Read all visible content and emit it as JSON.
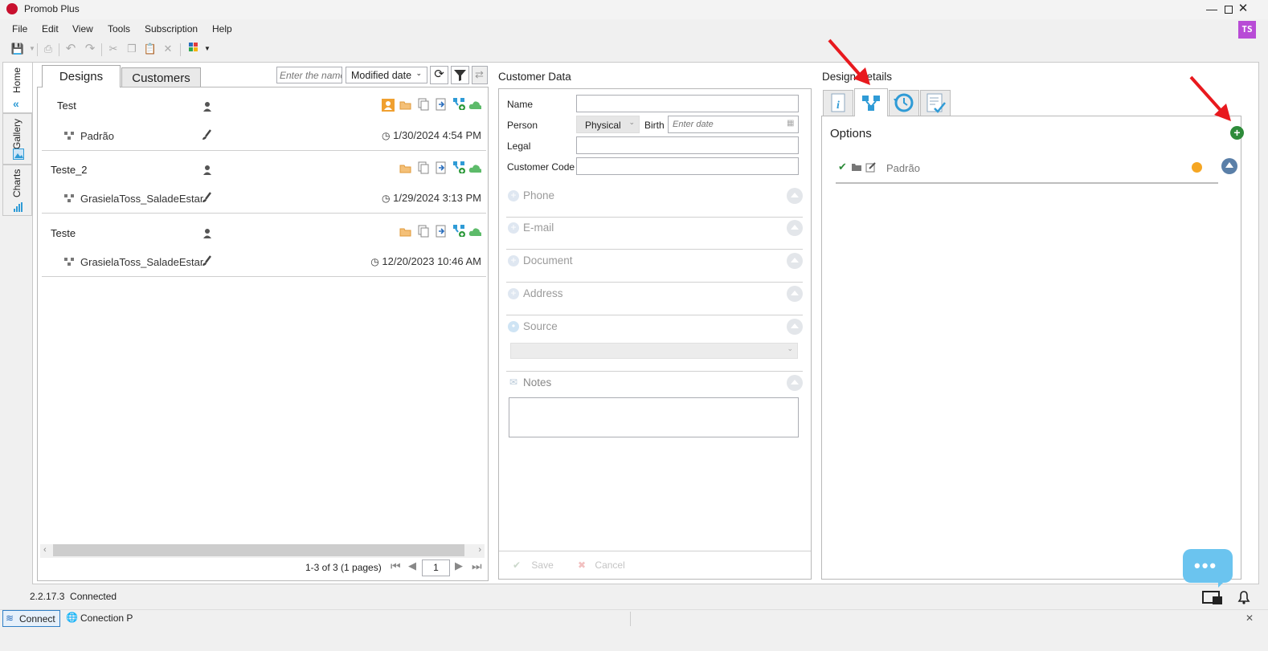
{
  "window": {
    "title": "Promob Plus",
    "avatar": "TS"
  },
  "menu": [
    "File",
    "Edit",
    "View",
    "Tools",
    "Subscription",
    "Help"
  ],
  "side_tabs": [
    "Home",
    "Gallery",
    "Charts"
  ],
  "designs_panel": {
    "tabs": [
      "Designs",
      "Customers"
    ],
    "search_placeholder": "Enter the name",
    "sort_value": "Modified date",
    "projects": [
      {
        "name": "Test",
        "option": "Padrão",
        "date": "1/30/2024 4:54 PM"
      },
      {
        "name": "Teste_2",
        "option": "GrasielaToss_SaladeEstar",
        "date": "1/29/2024 3:13 PM"
      },
      {
        "name": "Teste",
        "option": "GrasielaToss_SaladeEstar",
        "date": "12/20/2023 10:46 AM"
      }
    ],
    "pagination": {
      "summary": "1-3 of 3 (1 pages)",
      "page": "1"
    }
  },
  "customer_panel": {
    "title": "Customer Data",
    "labels": {
      "name": "Name",
      "person": "Person",
      "birth": "Birth",
      "legal": "Legal",
      "customer_code": "Customer Code"
    },
    "person_value": "Physical",
    "birth_placeholder": "Enter date",
    "sections": [
      "Phone",
      "E-mail",
      "Document",
      "Address",
      "Source",
      "Notes"
    ],
    "save_label": "Save",
    "cancel_label": "Cancel"
  },
  "details_panel": {
    "title": "Design Details",
    "options_title": "Options",
    "option_item": "Padrão",
    "status_color": "#f5a623"
  },
  "status": {
    "version": "2.2.17.3",
    "connection": "Connected",
    "tabs": [
      "Connect",
      "Conection P"
    ]
  },
  "colors": {
    "accent_blue": "#2f9bd6",
    "green": "#2e8b3a",
    "orange": "#f0a030",
    "chat_bubble": "#6bc4ef",
    "arrow_red": "#e8191e"
  }
}
